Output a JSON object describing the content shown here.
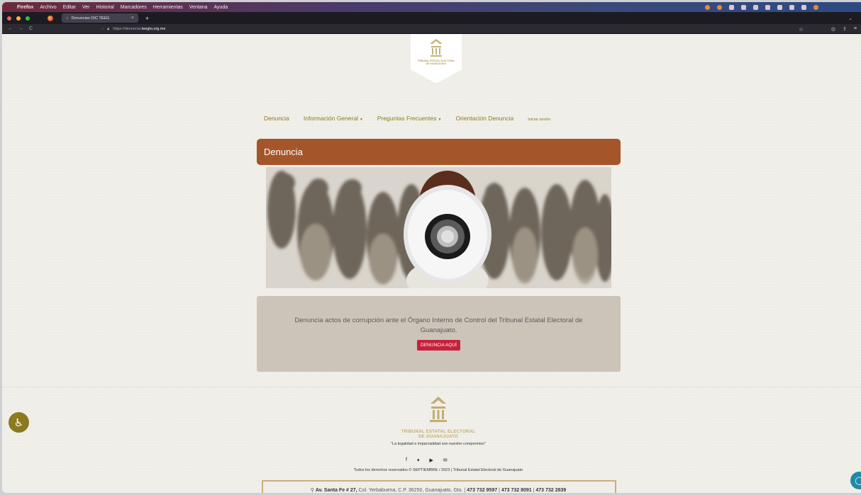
{
  "os_menubar": {
    "app": "Firefox",
    "items": [
      "Archivo",
      "Editar",
      "Ver",
      "Historial",
      "Marcadores",
      "Herramientas",
      "Ventana",
      "Ayuda"
    ]
  },
  "browser": {
    "tab_title": "Denuncias OIC TEEG",
    "url_prefix": "https://denuncia.",
    "url_domain": "teegto.org.mx"
  },
  "site": {
    "logo_text_line1": "TRIBUNAL ESTATAL ELECTORAL",
    "logo_text_line2": "DE GUANAJUATO",
    "nav": {
      "denuncia": "Denuncia",
      "info_general": "Información General",
      "preguntas": "Preguntas Frecuentes",
      "orientacion": "Orientación Denuncia",
      "login": "Iniciar sesión"
    },
    "card_title": "Denuncia",
    "info_text": "Denuncia actos de corrupción ante el Órgano Interno de Control del Tribunal Estatal Electoral de Guanajuato.",
    "cta_button": "DENUNCIA AQUÍ",
    "footer": {
      "org_line1": "TRIBUNAL ESTATAL ELECTORAL",
      "org_line2": "DE GUANAJUATO",
      "motto": "\"La legalidad e imparcialidad son nuestro compromiso\"",
      "copyright": "Todos los derechos reservados © SEPTIEMBRE / 2023 | Tribunal Estatal Electoral de Guanajuato",
      "address_bold": "Av. Santa Fe # 27,",
      "address_rest": "Col. Yerbabuena, C.P. 36250, Guanajuato, Gto.",
      "phone1": "473 732 9597",
      "phone2": "473 732 8091",
      "phone3": "473 732 2839"
    }
  }
}
